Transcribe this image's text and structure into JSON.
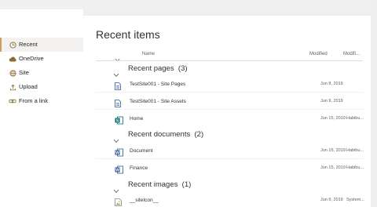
{
  "sidebar": {
    "items": [
      {
        "label": "Recent",
        "icon": "clock-icon",
        "active": true
      },
      {
        "label": "OneDrive",
        "icon": "cloud-icon",
        "active": false
      },
      {
        "label": "Site",
        "icon": "globe-icon",
        "active": false
      },
      {
        "label": "Upload",
        "icon": "upload-icon",
        "active": false
      },
      {
        "label": "From a link",
        "icon": "link-icon",
        "active": false
      }
    ]
  },
  "main": {
    "title": "Recent items",
    "columns": {
      "name": "Name",
      "modified": "Modified",
      "modified_by": "Modifi..."
    },
    "groups": [
      {
        "title": "Recent pages",
        "count": "(3)",
        "items": [
          {
            "name": "TestSite001 - Site Pages",
            "modified": "Jun 8, 2019",
            "modified_by": "",
            "icon": "page-icon"
          },
          {
            "name": "TestSite001 - Site Assets",
            "modified": "Jun 9, 2019",
            "modified_by": "",
            "icon": "page-icon"
          },
          {
            "name": "Home",
            "modified": "Jun 15, 2019",
            "modified_by": "Habibu...",
            "icon": "sharepoint-page-icon"
          }
        ]
      },
      {
        "title": "Recent documents",
        "count": "(2)",
        "items": [
          {
            "name": "Document",
            "modified": "Jun 15, 2019",
            "modified_by": "Habibu...",
            "icon": "word-document-icon"
          },
          {
            "name": "Finance",
            "modified": "Jun 15, 2019",
            "modified_by": "Habibu...",
            "icon": "word-document-icon"
          }
        ]
      },
      {
        "title": "Recent images",
        "count": "(1)",
        "items": [
          {
            "name": "__siteIcon__",
            "modified": "Jun 9, 2019",
            "modified_by": "System...",
            "icon": "image-file-icon"
          }
        ]
      }
    ]
  },
  "colors": {
    "accent": "#c7a25a",
    "word_blue": "#2b579a",
    "sharepoint_teal": "#036c70"
  }
}
